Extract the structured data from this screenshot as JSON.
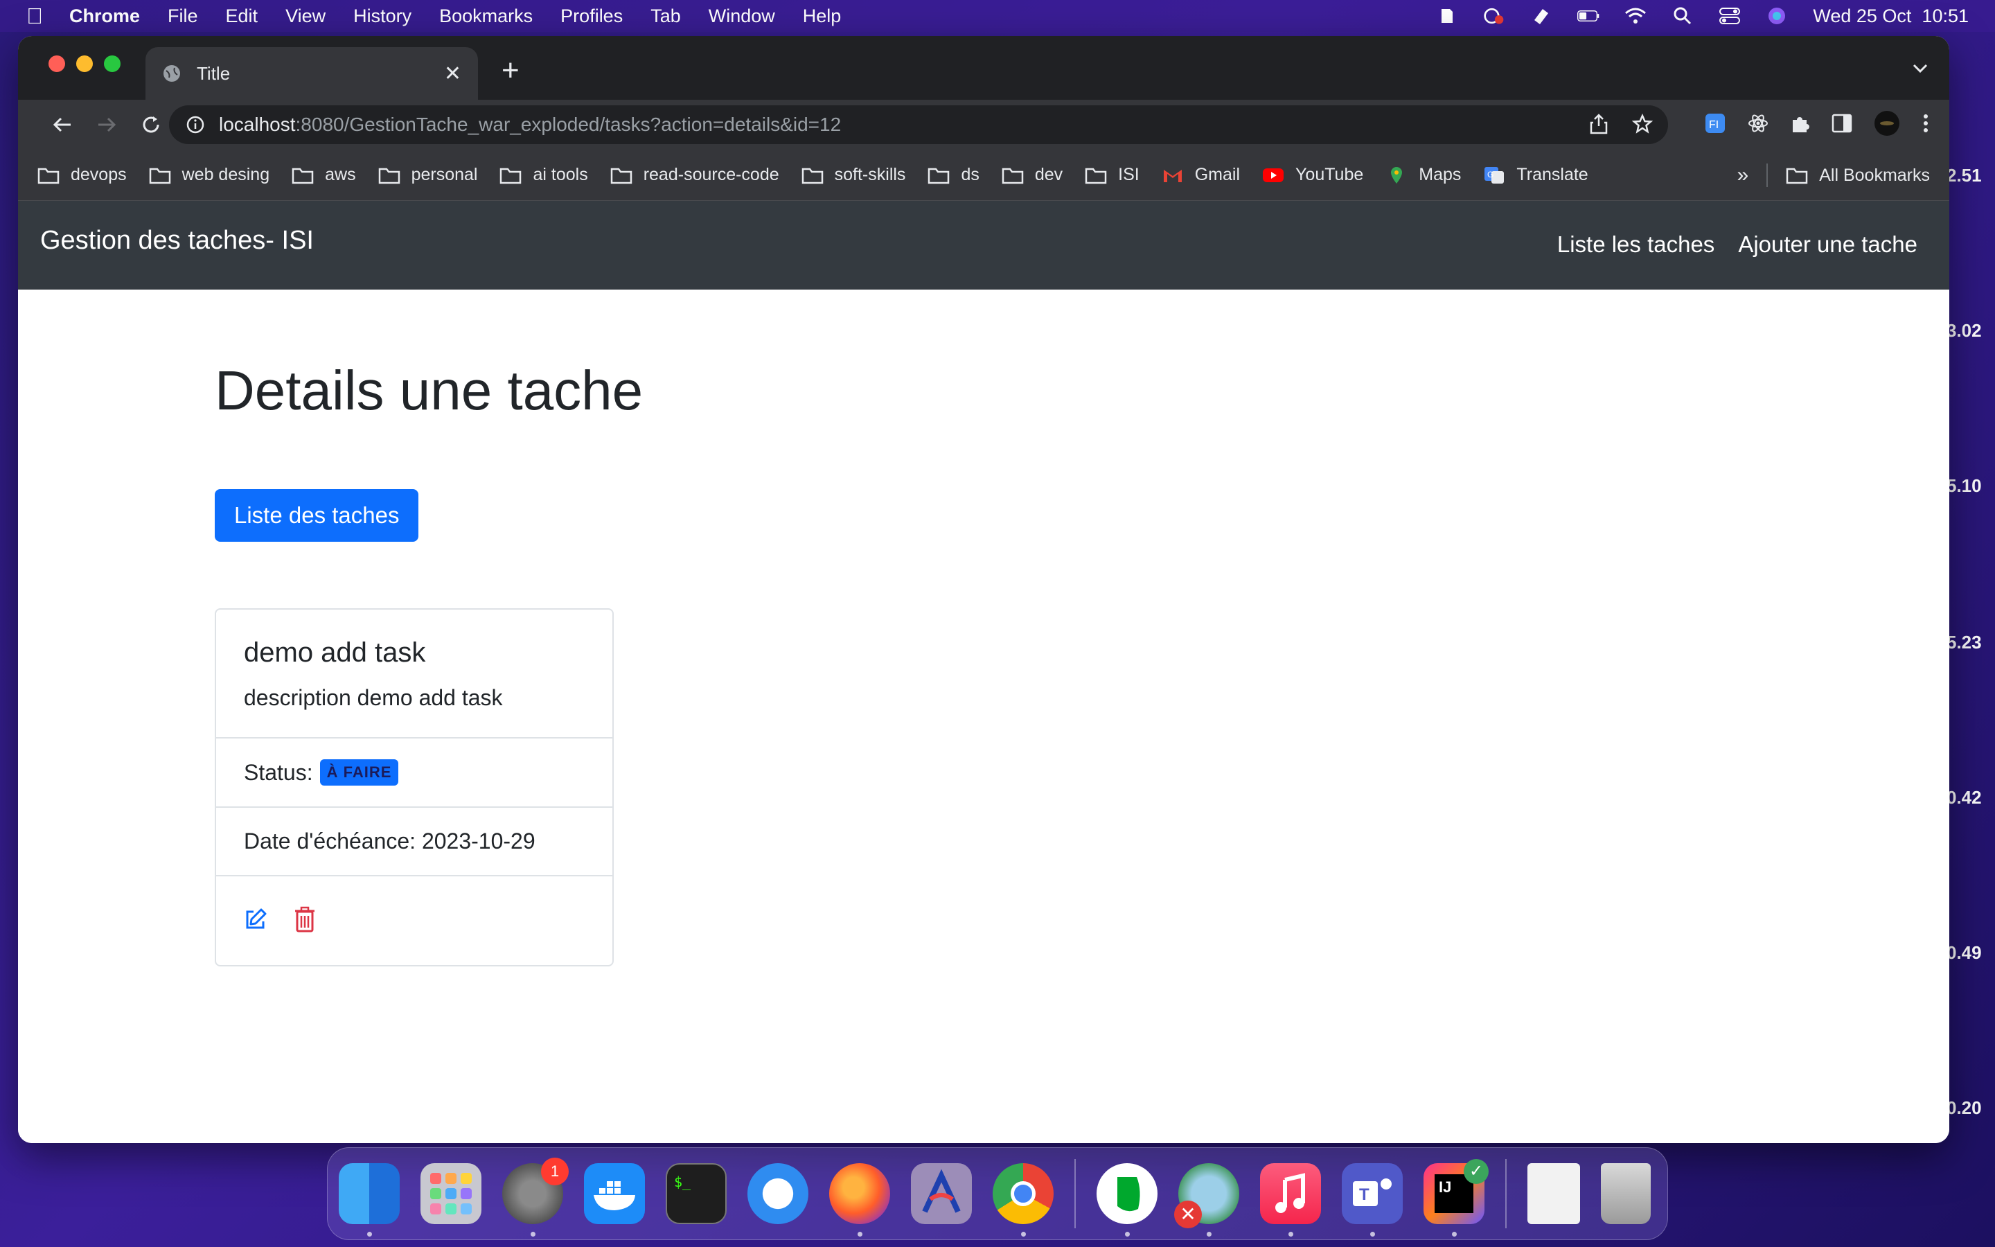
{
  "menubar": {
    "app": "Chrome",
    "items": [
      "File",
      "Edit",
      "View",
      "History",
      "Bookmarks",
      "Profiles",
      "Tab",
      "Window",
      "Help"
    ],
    "datetime": "Wed 25 Oct  10:51"
  },
  "side_values": [
    "2.51",
    "3.02",
    "5.10",
    "5.23",
    "0.42",
    "0.49",
    "0.20"
  ],
  "browser": {
    "tab_title": "Title",
    "url_host": "localhost",
    "url_rest": ":8080/GestionTache_war_exploded/tasks?action=details&id=12",
    "bookmarks": [
      "devops",
      "web desing",
      "aws",
      "personal",
      "ai tools",
      "read-source-code",
      "soft-skills",
      "ds",
      "dev",
      "ISI"
    ],
    "bookmark_links": [
      "Gmail",
      "YouTube",
      "Maps",
      "Translate"
    ],
    "overflow": "»",
    "all_bookmarks": "All Bookmarks"
  },
  "app": {
    "brand": "Gestion des taches- ISI",
    "nav": [
      "Liste les taches",
      "Ajouter une tache"
    ],
    "page_title": "Details une tache",
    "back_button": "Liste des taches",
    "task": {
      "title": "demo add task",
      "description": "description demo add task",
      "status_label": "Status:",
      "status_value": "À FAIRE",
      "due_label": "Date d'échéance:",
      "due_value": "2023-10-29"
    }
  },
  "colors": {
    "primary": "#0d6efd",
    "navbar": "#343a40",
    "danger": "#dc3545"
  },
  "dock": {
    "settings_badge": "1"
  }
}
